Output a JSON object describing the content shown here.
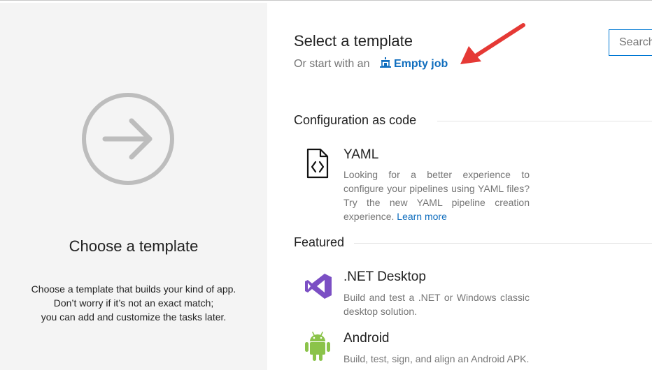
{
  "left_panel": {
    "title": "Choose a template",
    "description_lines": [
      "Choose a template that builds your kind of app.",
      "Don’t worry if it’s not an exact match;",
      "you can add and customize the tasks later."
    ]
  },
  "header": {
    "title": "Select a template",
    "start_prefix": "Or start with an",
    "empty_job_label": "Empty job"
  },
  "search": {
    "placeholder": "Search"
  },
  "sections": {
    "config": {
      "title": "Configuration as code",
      "items": [
        {
          "title": "YAML",
          "description": "Looking for a better experience to configure your pipelines using YAML files? Try the new YAML pipeline creation experience.",
          "link": "Learn more"
        }
      ]
    },
    "featured": {
      "title": "Featured",
      "items": [
        {
          "title": ".NET Desktop",
          "description": "Build and test a .NET or Windows classic desktop solution."
        },
        {
          "title": "Android",
          "description": "Build, test, sign, and align an Android APK."
        }
      ]
    }
  },
  "colors": {
    "accent": "#106ebe",
    "left_panel_bg": "#f4f4f4",
    "circle_icon": "#bdbdbd",
    "vs_purple": "#7b4fc4",
    "android_green": "#8bc34a",
    "annotation_arrow": "#e53935"
  },
  "icons": [
    "arrow-circle-icon",
    "build-icon",
    "yaml-file-icon",
    "visual-studio-icon",
    "android-icon",
    "annotation-arrow"
  ]
}
